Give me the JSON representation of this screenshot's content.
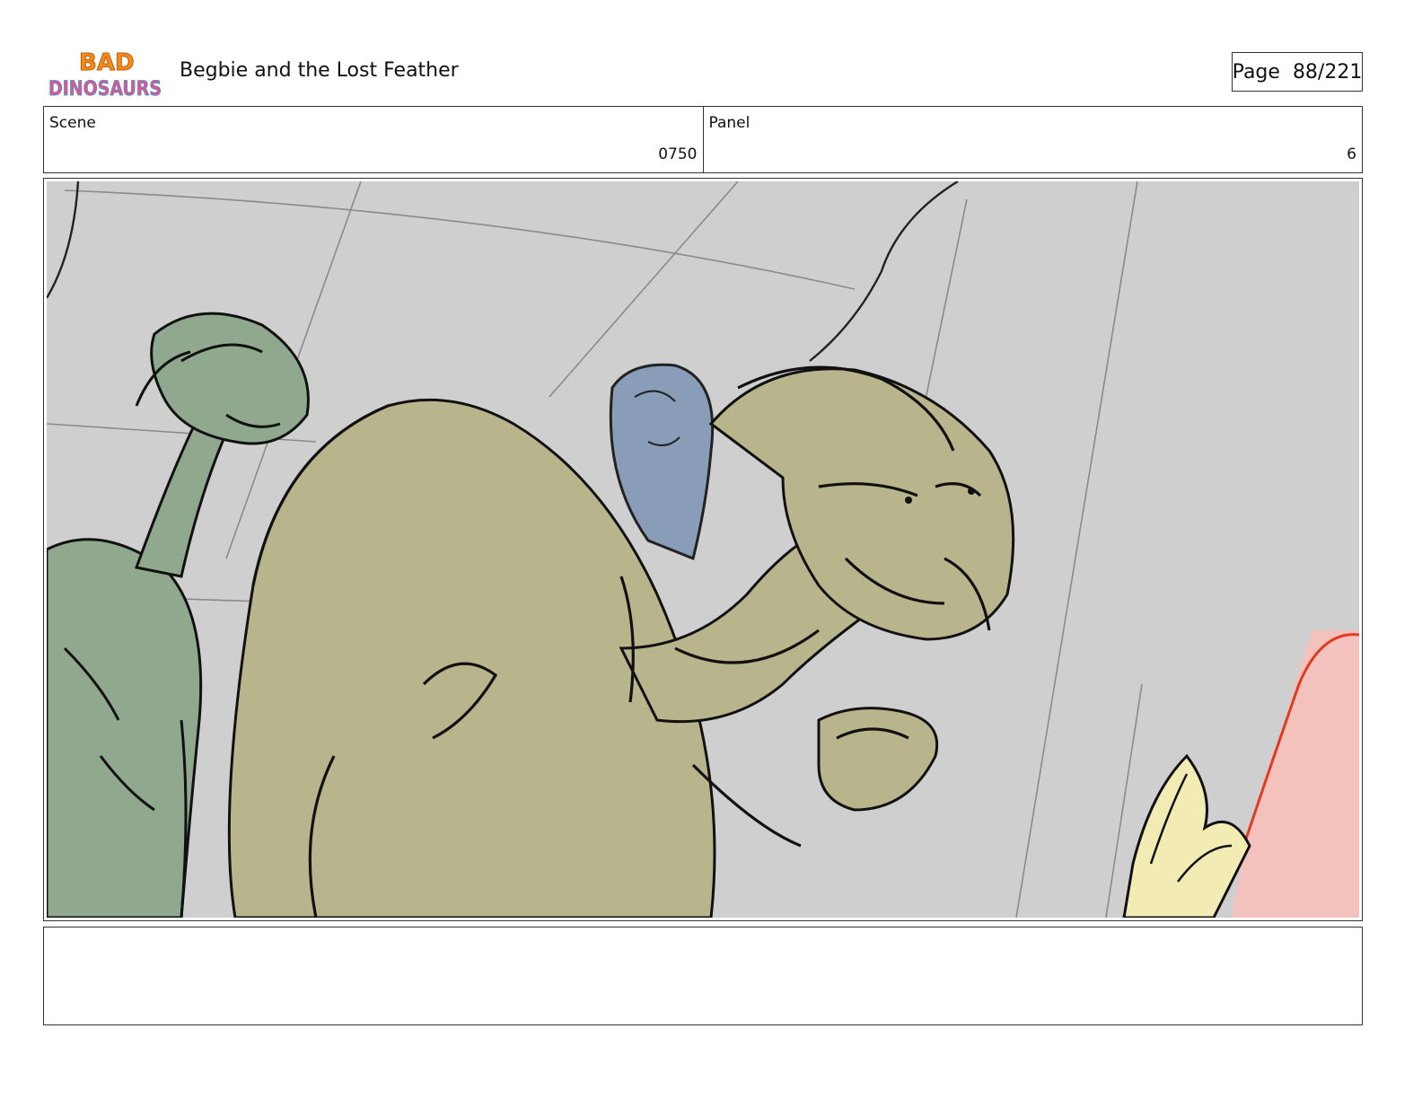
{
  "header": {
    "logo": {
      "line1": "BAD",
      "line2": "DINOSAURS",
      "icon": "bad-dinosaurs-logo"
    },
    "title": "Begbie and the Lost Feather",
    "page_label": "Page",
    "page_number": "88/221"
  },
  "info": {
    "scene_label": "Scene",
    "scene_value": "0750",
    "panel_label": "Panel",
    "panel_value": "6"
  },
  "panel": {
    "background_color": "#cfcfcf",
    "colors": {
      "green_dino": "#8fa88e",
      "olive_dino": "#b8b48c",
      "blue_dino": "#8a9db8",
      "pink_dino": "#f4c2bc",
      "pink_outline": "#e03a20",
      "yellow_dino": "#f2ecb4"
    }
  },
  "notes": {
    "text": ""
  }
}
